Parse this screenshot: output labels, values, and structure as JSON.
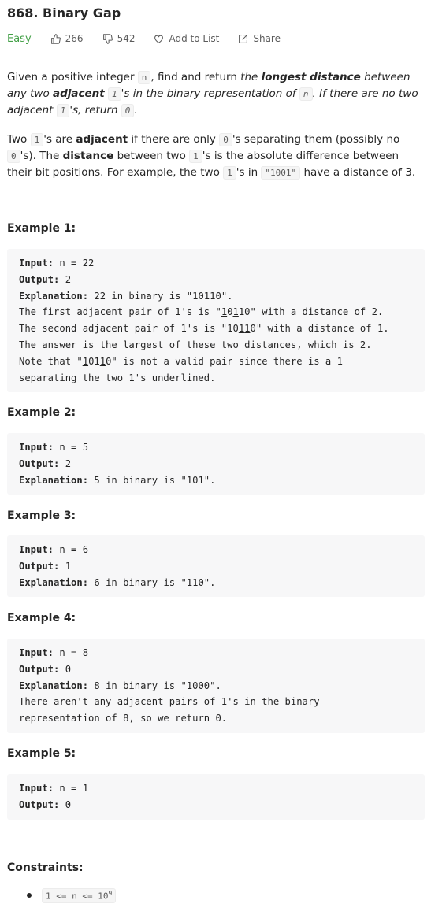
{
  "problem": {
    "title": "868. Binary Gap",
    "difficulty": "Easy",
    "likes": "266",
    "dislikes": "542",
    "add_to_list": "Add to List",
    "share": "Share"
  },
  "description": {
    "p1_a": "Given a positive integer ",
    "p1_code_n": "n",
    "p1_b": ", find and return ",
    "p1_c": "the ",
    "p1_longest": "longest distance",
    "p1_d": " between any two ",
    "p1_adjacent": "adjacent",
    "p1_code_1": "1",
    "p1_e": "'s in the binary representation of ",
    "p1_code_n2": "n",
    "p1_f": ". If there are no two adjacent ",
    "p1_code_1b": "1",
    "p1_g": "'s, return ",
    "p1_code_0": "0",
    "p1_h": ".",
    "p2_a": "Two ",
    "p2_code_1": "1",
    "p2_b": "'s are ",
    "p2_adjacent": "adjacent",
    "p2_c": " if there are only ",
    "p2_code_0": "0",
    "p2_d": "'s separating them (possibly no ",
    "p2_code_0b": "0",
    "p2_e": "'s). The ",
    "p2_distance": "distance",
    "p2_f": " between two ",
    "p2_code_1b": "1",
    "p2_g": "'s is the absolute difference between their bit positions. For example, the two ",
    "p2_code_1c": "1",
    "p2_h": "'s in ",
    "p2_code_1001": "\"1001\"",
    "p2_i": " have a distance of 3."
  },
  "labels": {
    "input": "Input:",
    "output": "Output:",
    "explanation": "Explanation:"
  },
  "examples": [
    {
      "heading": "Example 1:",
      "input": " n = 22",
      "output": " 2",
      "explanation": " 22 in binary is \"10110\".",
      "l1_a": "The first adjacent pair of 1's is \"",
      "l1_u1": "1",
      "l1_m": "0",
      "l1_u2": "1",
      "l1_b": "10\" with a distance of 2.",
      "l2_a": "The second adjacent pair of 1's is \"10",
      "l2_u1": "1",
      "l2_u2": "1",
      "l2_b": "0\" with a distance of 1.",
      "l3": "The answer is the largest of these two distances, which is 2.",
      "l4_a": "Note that \"",
      "l4_u1": "1",
      "l4_m": "01",
      "l4_u2": "1",
      "l4_b": "0\" is not a valid pair since there is a 1",
      "l5": "separating the two 1's underlined."
    },
    {
      "heading": "Example 2:",
      "input": " n = 5",
      "output": " 2",
      "explanation": " 5 in binary is \"101\"."
    },
    {
      "heading": "Example 3:",
      "input": " n = 6",
      "output": " 1",
      "explanation": " 6 in binary is \"110\"."
    },
    {
      "heading": "Example 4:",
      "input": " n = 8",
      "output": " 0",
      "explanation": " 8 in binary is \"1000\".",
      "l1": "There aren't any adjacent pairs of 1's in the binary",
      "l2": "representation of 8, so we return 0."
    },
    {
      "heading": "Example 5:",
      "input": " n = 1",
      "output": " 0"
    }
  ],
  "constraints": {
    "heading": "Constraints:",
    "item_base": "1 <= n <= 10",
    "item_exp": "9"
  },
  "colors": {
    "easy": "#43a047",
    "code_bg": "#f7f7f8"
  }
}
